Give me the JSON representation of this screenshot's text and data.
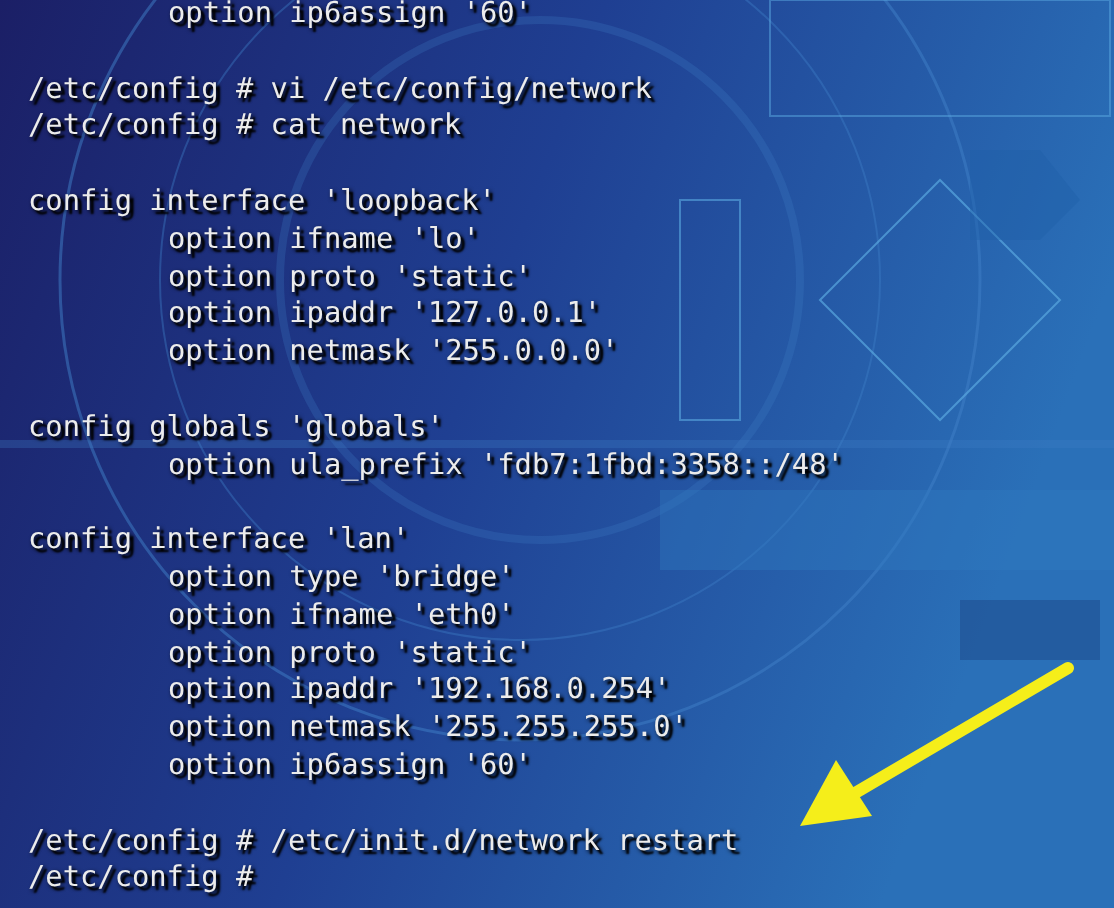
{
  "terminal": {
    "lines": [
      {
        "kind": "indented",
        "text": "option ip6assign '60'"
      },
      {
        "kind": "gap"
      },
      {
        "kind": "plain",
        "text": "/etc/config # vi /etc/config/network"
      },
      {
        "kind": "plain",
        "text": "/etc/config # cat network"
      },
      {
        "kind": "gap"
      },
      {
        "kind": "plain",
        "text": "config interface 'loopback'"
      },
      {
        "kind": "indented",
        "text": "option ifname 'lo'"
      },
      {
        "kind": "indented",
        "text": "option proto 'static'"
      },
      {
        "kind": "indented",
        "text": "option ipaddr '127.0.0.1'"
      },
      {
        "kind": "indented",
        "text": "option netmask '255.0.0.0'"
      },
      {
        "kind": "gap"
      },
      {
        "kind": "plain",
        "text": "config globals 'globals'"
      },
      {
        "kind": "indented",
        "text": "option ula_prefix 'fdb7:1fbd:3358::/48'"
      },
      {
        "kind": "gap"
      },
      {
        "kind": "plain",
        "text": "config interface 'lan'"
      },
      {
        "kind": "indented",
        "text": "option type 'bridge'"
      },
      {
        "kind": "indented",
        "text": "option ifname 'eth0'"
      },
      {
        "kind": "indented",
        "text": "option proto 'static'"
      },
      {
        "kind": "indented",
        "text": "option ipaddr '192.168.0.254'"
      },
      {
        "kind": "indented",
        "text": "option netmask '255.255.255.0'"
      },
      {
        "kind": "indented",
        "text": "option ip6assign '60'"
      },
      {
        "kind": "gap"
      },
      {
        "kind": "plain",
        "text": "/etc/config # /etc/init.d/network restart"
      },
      {
        "kind": "plain",
        "text": "/etc/config #"
      }
    ]
  }
}
